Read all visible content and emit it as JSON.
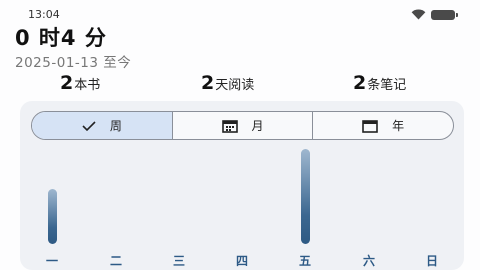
{
  "status_bar": {
    "time": "13:04"
  },
  "summary": {
    "total_time": "0 时4 分",
    "since": "2025-01-13 至今"
  },
  "stats": [
    {
      "num": "2",
      "label": "本书"
    },
    {
      "num": "2",
      "label": "天阅读"
    },
    {
      "num": "2",
      "label": "条笔记"
    }
  ],
  "range_tabs": [
    {
      "label": "周",
      "icon": "check-icon",
      "selected": true
    },
    {
      "label": "月",
      "icon": "calendar-icon",
      "selected": false
    },
    {
      "label": "年",
      "icon": "calendar-blank-icon",
      "selected": false
    }
  ],
  "chart_data": {
    "type": "bar",
    "categories": [
      "一",
      "二",
      "三",
      "四",
      "五",
      "六",
      "日"
    ],
    "values": [
      0.55,
      0,
      0,
      0,
      0.95,
      0,
      0
    ],
    "bar_gradient": [
      "#9fb7cf",
      "#2e5a84"
    ],
    "label_color": "#2d5a86"
  }
}
